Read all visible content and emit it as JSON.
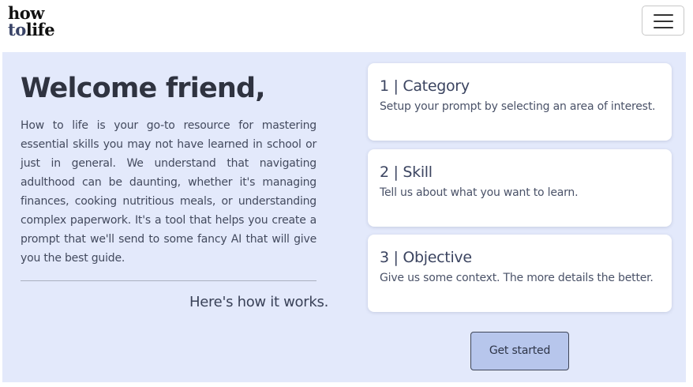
{
  "brand": {
    "line1": "how",
    "line2_a": "to",
    "line2_b": "life"
  },
  "header": {
    "menu_icon": "hamburger-menu-icon"
  },
  "hero": {
    "title": "Welcome friend,",
    "intro": "How to life is your go-to resource for mastering essential skills you may not have learned in school or just in general. We understand that navigating adulthood can be daunting, whether it's managing finances, cooking nutritious meals, or understanding complex paperwork. It's a tool that helps you create a prompt that we'll send to some fancy AI that will give you the best guide.",
    "how_it_works": "Here's how it works."
  },
  "steps": [
    {
      "title": "1 | Category",
      "description": "Setup your prompt by selecting an area of interest."
    },
    {
      "title": "2 | Skill",
      "description": "Tell us about what you want to learn."
    },
    {
      "title": "3 | Objective",
      "description": "Give us some context. The more details the better."
    }
  ],
  "cta": {
    "label": "Get started"
  },
  "colors": {
    "background": "#e3e9fb",
    "card": "#ffffff",
    "button": "#b7c6ec",
    "heading": "#2f3340",
    "logo_accent": "#3a4468"
  }
}
